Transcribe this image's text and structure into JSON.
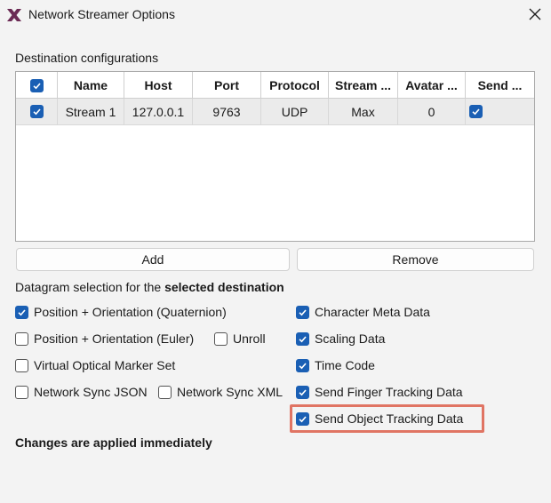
{
  "window": {
    "title": "Network Streamer Options"
  },
  "destinations": {
    "label": "Destination configurations",
    "columns": [
      "Name",
      "Host",
      "Port",
      "Protocol",
      "Stream ...",
      "Avatar ...",
      "Send ..."
    ],
    "header_checkbox_checked": true,
    "rows": [
      {
        "enabled": true,
        "name": "Stream 1",
        "host": "127.0.0.1",
        "port": "9763",
        "protocol": "UDP",
        "stream": "Max",
        "avatar": "0",
        "send": true
      }
    ]
  },
  "buttons": {
    "add": "Add",
    "remove": "Remove"
  },
  "datagram": {
    "label_prefix": "Datagram selection for the ",
    "label_bold": "selected destination",
    "options": {
      "position_quaternion": {
        "label": "Position + Orientation (Quaternion)",
        "checked": true
      },
      "position_euler": {
        "label": "Position + Orientation (Euler)",
        "checked": false
      },
      "unroll": {
        "label": "Unroll",
        "checked": false
      },
      "virtual_marker": {
        "label": "Virtual Optical Marker Set",
        "checked": false
      },
      "sync_json": {
        "label": "Network Sync JSON",
        "checked": false
      },
      "sync_xml": {
        "label": "Network Sync XML",
        "checked": false
      },
      "character_meta": {
        "label": "Character Meta Data",
        "checked": true
      },
      "scaling": {
        "label": "Scaling Data",
        "checked": true
      },
      "time_code": {
        "label": "Time Code",
        "checked": true
      },
      "finger_tracking": {
        "label": "Send Finger Tracking Data",
        "checked": true
      },
      "object_tracking": {
        "label": "Send Object Tracking Data",
        "checked": true
      }
    }
  },
  "footer": {
    "note": "Changes are applied immediately"
  },
  "colors": {
    "accent": "#1a5fb4",
    "highlight": "#e07463",
    "logo": "#6b2a54"
  }
}
